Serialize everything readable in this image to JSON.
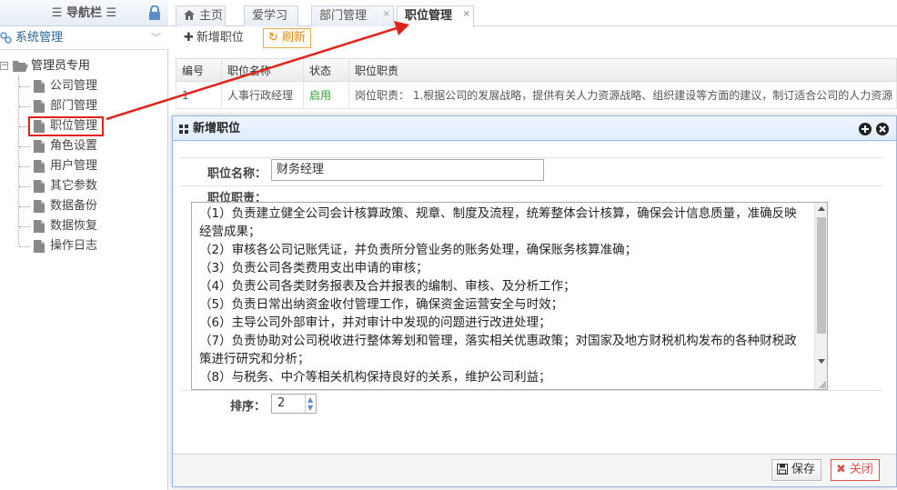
{
  "sidebar": {
    "title": "导航栏",
    "section": "系统管理",
    "tree_root": "管理员专用",
    "items": [
      {
        "label": "公司管理"
      },
      {
        "label": "部门管理"
      },
      {
        "label": "职位管理"
      },
      {
        "label": "角色设置"
      },
      {
        "label": "用户管理"
      },
      {
        "label": "其它参数"
      },
      {
        "label": "数据备份"
      },
      {
        "label": "数据恢复"
      },
      {
        "label": "操作日志"
      }
    ],
    "selected_index": 2
  },
  "tabs": [
    {
      "label": "主页"
    },
    {
      "label": "爱学习"
    },
    {
      "label": "部门管理"
    },
    {
      "label": "职位管理"
    }
  ],
  "active_tab": 3,
  "toolbar": {
    "add_label": "新增职位",
    "refresh_label": "刷新"
  },
  "table": {
    "headers": [
      "编号",
      "职位名称",
      "状态",
      "职位职责"
    ],
    "rows": [
      {
        "id": "1",
        "name": "人事行政经理",
        "status": "启用",
        "duty": "岗位职责： 1.根据公司的发展战略，提供有关人力资源战略、组织建设等方面的建议，制订适合公司的人力资源"
      }
    ]
  },
  "dialog": {
    "title": "新增职位",
    "name_label": "职位名称：",
    "name_value": "财务经理",
    "duty_label": "职位职责：",
    "duty_text": "（1）负责建立健全公司会计核算政策、规章、制度及流程，统筹整体会计核算，确保会计信息质量，准确反映经营成果；\n（2）审核各公司记账凭证，并负责所分管业务的账务处理，确保账务核算准确；\n（3）负责公司各类费用支出申请的审核；\n（4）负责公司各类财务报表及合并报表的编制、审核、及分析工作；\n（5）负责日常出纳资金收付管理工作，确保资金运营安全与时效；\n（6）主导公司外部审计，并对审计中发现的问题进行改进处理；\n（7）负责协助对公司税收进行整体筹划和管理，落实相关优惠政策；对国家及地方财税机构发布的各种财税政策进行研究和分析；\n（8）与税务、中介等相关机构保持良好的关系，维护公司利益；",
    "order_label": "排序：",
    "order_value": "2",
    "save_label": "保存",
    "close_label": "关闭"
  },
  "colors": {
    "accent": "#e2231a",
    "border": "#95b8e7",
    "status_green": "#2e9e2e"
  }
}
